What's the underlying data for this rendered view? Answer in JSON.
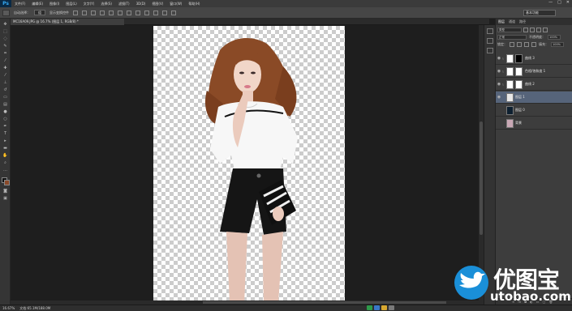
{
  "app": {
    "logo": "Ps",
    "menu": [
      "文件(F)",
      "编辑(E)",
      "图像(I)",
      "图层(L)",
      "文字(Y)",
      "选择(S)",
      "滤镜(T)",
      "3D(D)",
      "视图(V)",
      "窗口(W)",
      "帮助(H)"
    ],
    "window_controls": [
      "—",
      "□",
      "✕"
    ]
  },
  "options_bar": {
    "auto_select_label": "自动选择：",
    "auto_select_value": "组",
    "transform_label": "显示变换控件",
    "workspace": "基本功能"
  },
  "document": {
    "tab_title": "MC16A09.JPG @ 16.7% (图层 1, RGB/8) *"
  },
  "status": {
    "zoom": "16.67%",
    "doc_info": "文档:65.1M/188.0M"
  },
  "layers_panel": {
    "tabs": [
      "图层",
      "通道",
      "路径"
    ],
    "filter_kind": "类型",
    "blend_mode": "正常",
    "opacity_label": "不透明度：",
    "opacity_value": "100%",
    "lock_label": "锁定：",
    "fill_label": "填充：",
    "fill_value": "100%",
    "layers": [
      {
        "name": "曲线 3",
        "selected": false
      },
      {
        "name": "色相/饱和度 1",
        "selected": false
      },
      {
        "name": "曲线 2",
        "selected": false
      },
      {
        "name": "图层 1",
        "selected": true
      },
      {
        "name": "图层 0",
        "selected": false
      },
      {
        "name": "背景",
        "selected": false
      }
    ]
  },
  "watermark": {
    "brand": "优图宝",
    "url": "utobao.com"
  },
  "colors": {
    "accent_selected": "#56647a",
    "ps_blue": "#35a9f2",
    "watermark_blue": "#1a8fd8"
  }
}
